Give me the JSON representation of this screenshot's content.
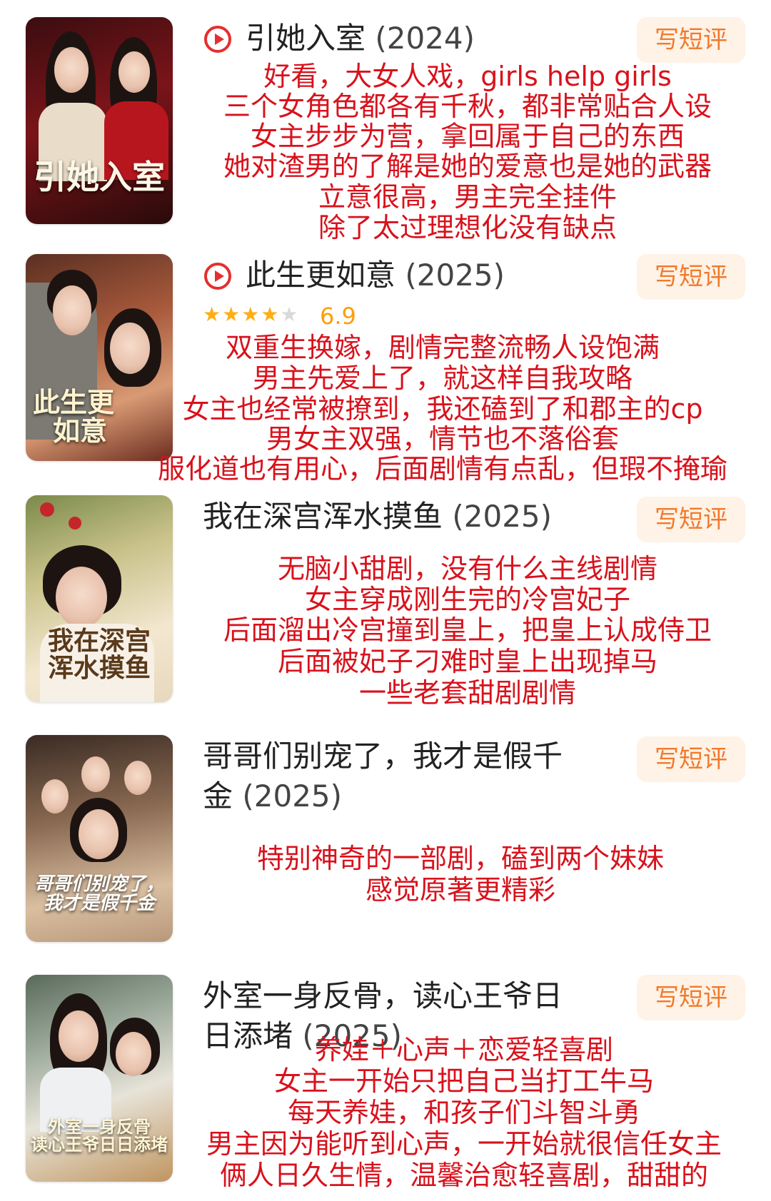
{
  "items": [
    {
      "title": "引她入室",
      "year": "(2024)",
      "button": "写短评",
      "poster_title": "引她入室",
      "notes": [
        "好看，大女人戏，girls help girls",
        "三个女角色都各有千秋，都非常贴合人设",
        "女主步步为营，拿回属于自己的东西",
        "她对渣男的了解是她的爱意也是她的武器",
        "立意很高，男主完全挂件",
        "除了太过理想化没有缺点"
      ]
    },
    {
      "title": "此生更如意",
      "year": "(2025)",
      "button": "写短评",
      "rating_stars": 3.5,
      "rating": "6.9",
      "poster_title_1": "此生更",
      "poster_title_2": "如意",
      "notes": [
        "双重生换嫁，剧情完整流畅人设饱满",
        "男主先爱上了，就这样自我攻略",
        "女主也经常被撩到，我还磕到了和郡主的cp",
        "男女主双强，情节也不落俗套",
        "服化道也有用心，后面剧情有点乱，但瑕不掩瑜"
      ]
    },
    {
      "title": "我在深宫浑水摸鱼",
      "year": "(2025)",
      "button": "写短评",
      "poster_title_1": "我在深宫",
      "poster_title_2": "浑水摸鱼",
      "notes": [
        "无脑小甜剧，没有什么主线剧情",
        "女主穿成刚生完的冷宫妃子",
        "后面溜出冷宫撞到皇上，把皇上认成侍卫",
        "后面被妃子刁难时皇上出现掉马",
        "一些老套甜剧剧情"
      ]
    },
    {
      "title_line1": "哥哥们别宠了，我才是假千",
      "title_line2": "金",
      "year": "(2025)",
      "button": "写短评",
      "poster_title_1": "哥哥们别宠了，",
      "poster_title_2": "我才是假千金",
      "notes": [
        "特别神奇的一部剧，磕到两个妹妹",
        "感觉原著更精彩"
      ]
    },
    {
      "title_line1": "外室一身反骨，读心王爷日",
      "title_line2": "日添堵",
      "year": "(2025)",
      "button": "写短评",
      "poster_title_1": "外室一身反骨",
      "poster_title_2": "读心王爷日日添堵",
      "notes": [
        "养娃＋心声＋恋爱轻喜剧",
        "女主一开始只把自己当打工牛马",
        "每天养娃，和孩子们斗智斗勇",
        "男主因为能听到心声，一开始就很信任女主",
        "俩人日久生情，温馨治愈轻喜剧，甜甜的"
      ]
    }
  ]
}
